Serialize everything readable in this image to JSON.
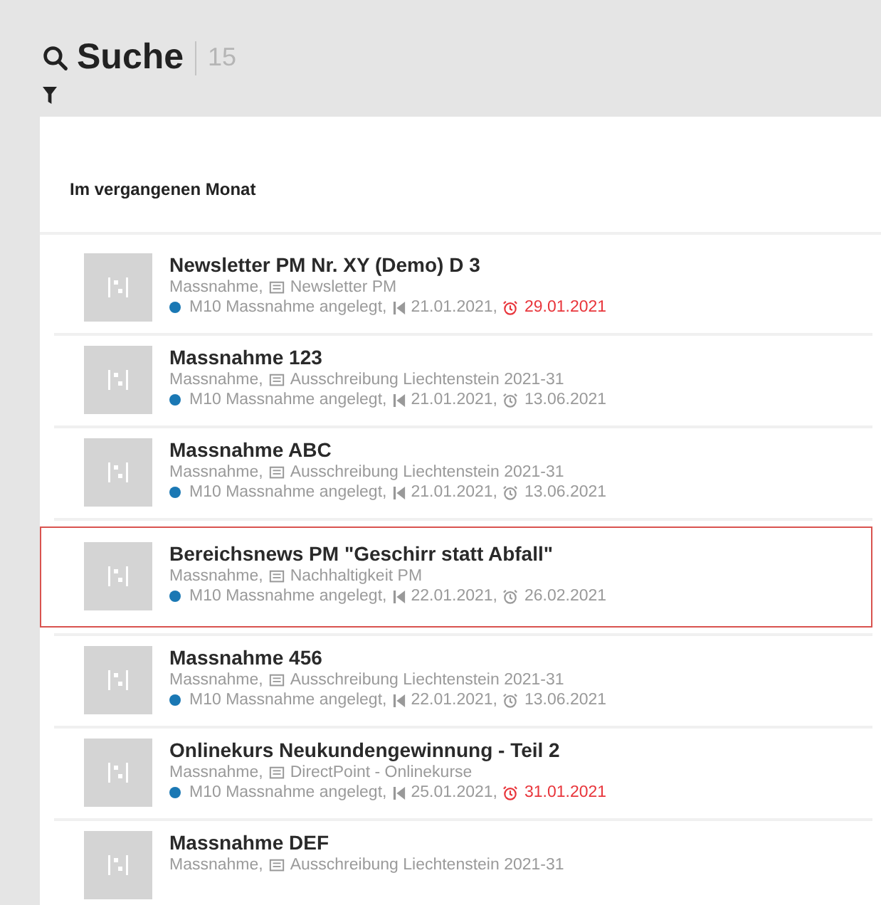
{
  "header": {
    "title": "Suche",
    "count": "15"
  },
  "section": {
    "title": "Im vergangenen Monat"
  },
  "results": [
    {
      "title": "Newsletter PM Nr. XY (Demo) D 3",
      "type": "Massnahme,",
      "channel": "Newsletter PM",
      "meta": {
        "status": "M10 Massnahme angelegt,",
        "color": "#1a78b4",
        "start": "21.01.2021,",
        "due": "29.01.2021",
        "overdue": true
      },
      "selected": false
    },
    {
      "title": "Massnahme 123",
      "type": "Massnahme,",
      "channel": "Ausschreibung Liechtenstein 2021-31",
      "meta": {
        "status": "M10 Massnahme angelegt,",
        "color": "#1a78b4",
        "start": "21.01.2021,",
        "due": "13.06.2021",
        "overdue": false
      },
      "selected": false
    },
    {
      "title": "Massnahme ABC",
      "type": "Massnahme,",
      "channel": "Ausschreibung Liechtenstein 2021-31",
      "meta": {
        "status": "M10 Massnahme angelegt,",
        "color": "#1a78b4",
        "start": "21.01.2021,",
        "due": "13.06.2021",
        "overdue": false
      },
      "selected": false
    },
    {
      "title": "Bereichsnews PM \"Geschirr statt Abfall\"",
      "type": "Massnahme,",
      "channel": "Nachhaltigkeit PM",
      "meta": {
        "status": "M10 Massnahme angelegt,",
        "color": "#1a78b4",
        "start": "22.01.2021,",
        "due": "26.02.2021",
        "overdue": false
      },
      "selected": true
    },
    {
      "title": "Massnahme 456",
      "type": "Massnahme,",
      "channel": "Ausschreibung Liechtenstein 2021-31",
      "meta": {
        "status": "M10 Massnahme angelegt,",
        "color": "#1a78b4",
        "start": "22.01.2021,",
        "due": "13.06.2021",
        "overdue": false
      },
      "selected": false
    },
    {
      "title": "Onlinekurs Neukundengewinnung - Teil 2",
      "type": "Massnahme,",
      "channel": "DirectPoint - Onlinekurse",
      "meta": {
        "status": "M10 Massnahme angelegt,",
        "color": "#1a78b4",
        "start": "25.01.2021,",
        "due": "31.01.2021",
        "overdue": true
      },
      "selected": false
    },
    {
      "title": "Massnahme DEF",
      "type": "Massnahme,",
      "channel": "Ausschreibung Liechtenstein 2021-31",
      "selected": false
    }
  ]
}
